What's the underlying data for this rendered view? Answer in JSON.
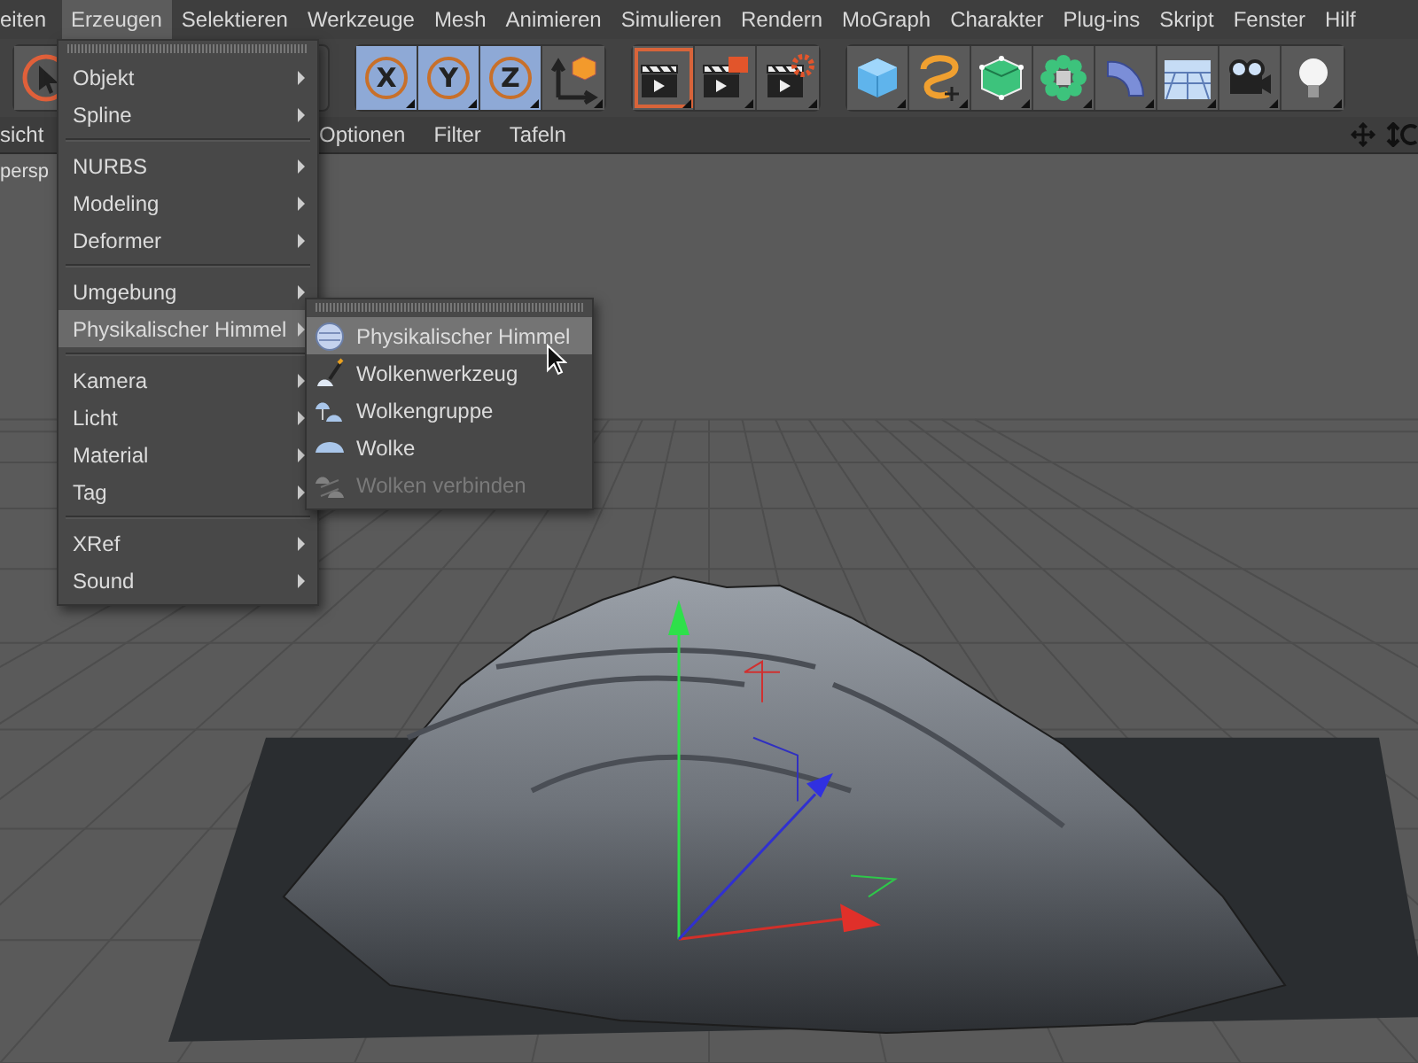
{
  "menu_bar": {
    "items": [
      {
        "label": "eiten",
        "selected": false
      },
      {
        "label": "Erzeugen",
        "selected": true
      },
      {
        "label": "Selektieren",
        "selected": false
      },
      {
        "label": "Werkzeuge",
        "selected": false
      },
      {
        "label": "Mesh",
        "selected": false
      },
      {
        "label": "Animieren",
        "selected": false
      },
      {
        "label": "Simulieren",
        "selected": false
      },
      {
        "label": "Rendern",
        "selected": false
      },
      {
        "label": "MoGraph",
        "selected": false
      },
      {
        "label": "Charakter",
        "selected": false
      },
      {
        "label": "Plug-ins",
        "selected": false
      },
      {
        "label": "Skript",
        "selected": false
      },
      {
        "label": "Fenster",
        "selected": false
      },
      {
        "label": "Hilf",
        "selected": false
      }
    ]
  },
  "toolbar": {
    "groups": [
      [
        {
          "kind": "select"
        }
      ],
      [
        {
          "kind": "axis",
          "label": "X",
          "on": true
        },
        {
          "kind": "axis",
          "label": "Y",
          "on": true
        },
        {
          "kind": "axis",
          "label": "Z",
          "on": true
        },
        {
          "kind": "coords"
        }
      ],
      [
        {
          "kind": "render-view",
          "on": true
        },
        {
          "kind": "render-picture",
          "on": false
        },
        {
          "kind": "render-settings",
          "on": false
        }
      ],
      [
        {
          "kind": "cube"
        },
        {
          "kind": "spline"
        },
        {
          "kind": "polygon-cube"
        },
        {
          "kind": "cloner"
        },
        {
          "kind": "bend"
        },
        {
          "kind": "floor"
        },
        {
          "kind": "camera"
        },
        {
          "kind": "light"
        }
      ]
    ]
  },
  "view_menu": {
    "items": [
      "sicht",
      "Optionen",
      "Filter",
      "Tafeln"
    ]
  },
  "viewport": {
    "label": "persp"
  },
  "create_menu": {
    "sections": [
      [
        {
          "label": "Objekt",
          "selected": false
        },
        {
          "label": "Spline",
          "selected": false
        }
      ],
      [
        {
          "label": "NURBS",
          "selected": false
        },
        {
          "label": "Modeling",
          "selected": false
        },
        {
          "label": "Deformer",
          "selected": false
        }
      ],
      [
        {
          "label": "Umgebung",
          "selected": false
        },
        {
          "label": "Physikalischer Himmel",
          "selected": true
        }
      ],
      [
        {
          "label": "Kamera",
          "selected": false
        },
        {
          "label": "Licht",
          "selected": false
        },
        {
          "label": "Material",
          "selected": false
        },
        {
          "label": "Tag",
          "selected": false
        }
      ],
      [
        {
          "label": "XRef",
          "selected": false
        },
        {
          "label": "Sound",
          "selected": false
        }
      ]
    ]
  },
  "submenu": {
    "items": [
      {
        "kind": "sky",
        "label": "Physikalischer Himmel",
        "selected": true,
        "disabled": false
      },
      {
        "kind": "cloud-tool",
        "label": "Wolkenwerkzeug",
        "selected": false,
        "disabled": false
      },
      {
        "kind": "cloud-group",
        "label": "Wolkengruppe",
        "selected": false,
        "disabled": false
      },
      {
        "kind": "cloud",
        "label": "Wolke",
        "selected": false,
        "disabled": false
      },
      {
        "kind": "cloud-merge",
        "label": "Wolken verbinden",
        "selected": false,
        "disabled": true
      }
    ]
  }
}
